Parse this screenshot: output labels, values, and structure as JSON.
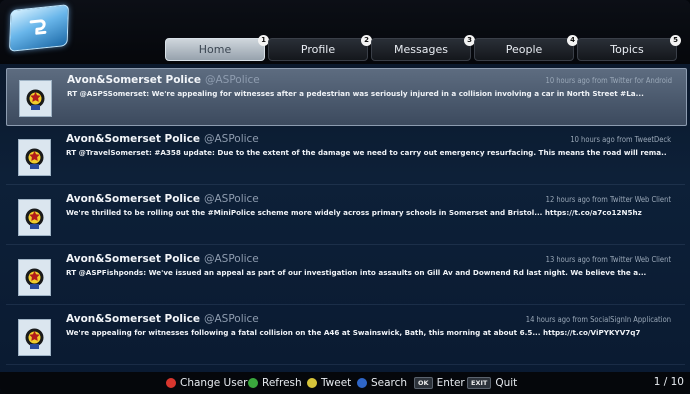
{
  "app": {
    "logo_icon": "twitter-bird-icon"
  },
  "tabs": [
    {
      "label": "Home",
      "badge": "",
      "active": true
    },
    {
      "label": "Profile",
      "badge": "2",
      "active": false
    },
    {
      "label": "Messages",
      "badge": "3",
      "active": false
    },
    {
      "label": "People",
      "badge": "4",
      "active": false
    },
    {
      "label": "Topics",
      "badge": "5",
      "active": false
    }
  ],
  "tweets": [
    {
      "name": "Avon&Somerset Police",
      "handle": "@ASPolice",
      "meta": "10 hours ago from Twitter for Android",
      "text": "RT @ASPSSomerset: We're appealing for witnesses after a pedestrian was seriously injured in a collision involving a car in North Street #La...",
      "selected": true
    },
    {
      "name": "Avon&Somerset Police",
      "handle": "@ASPolice",
      "meta": "10 hours ago from TweetDeck",
      "text": "RT @TravelSomerset: #A358 update: Due to the extent of the damage we need to carry out emergency resurfacing. This means the road will rema...",
      "selected": false
    },
    {
      "name": "Avon&Somerset Police",
      "handle": "@ASPolice",
      "meta": "12 hours ago from Twitter Web Client",
      "text": "We're thrilled to be rolling out the #MiniPolice scheme more widely across primary schools in Somerset and Bristol...  https://t.co/a7co12N5hz",
      "selected": false
    },
    {
      "name": "Avon&Somerset Police",
      "handle": "@ASPolice",
      "meta": "13 hours ago from Twitter Web Client",
      "text": "RT @ASPFishponds: We've issued an appeal as part of our investigation into assaults on Gill Av and Downend Rd last night. We believe the a...",
      "selected": false
    },
    {
      "name": "Avon&Somerset Police",
      "handle": "@ASPolice",
      "meta": "14 hours ago from SocialSignIn Application",
      "text": "We're appealing for witnesses following a fatal collision on the A46 at Swainswick, Bath, this morning at about 6.5...  https://t.co/ViPYKYV7q7",
      "selected": false
    }
  ],
  "footer": {
    "change_user": "Change User",
    "refresh": "Refresh",
    "tweet": "Tweet",
    "search": "Search",
    "ok_key": "OK",
    "enter": "Enter",
    "exit_key": "EXIT",
    "quit": "Quit",
    "pager": "1 / 10"
  },
  "colors": {
    "red": "#d8362e",
    "green": "#3aa83d",
    "yellow": "#d7c43a",
    "blue": "#2f66c8"
  }
}
